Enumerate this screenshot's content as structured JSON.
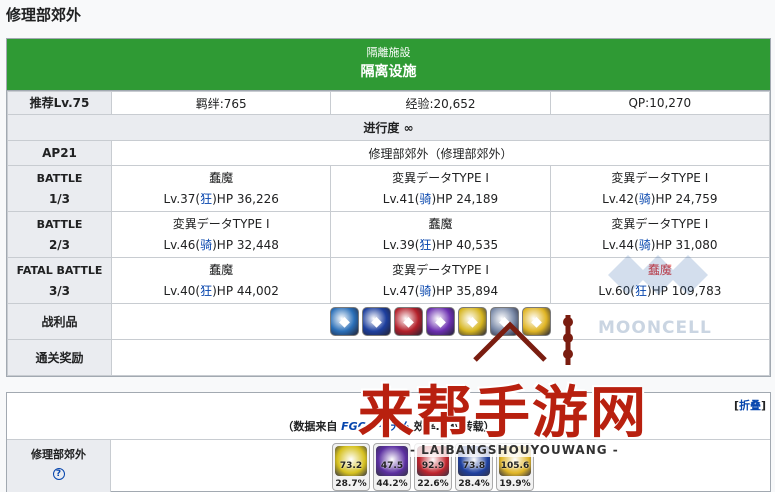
{
  "page": {
    "title": "修理部郊外"
  },
  "quest": {
    "jp_title": "隔離施設",
    "cn_title": "隔离设施",
    "info": {
      "recommend_label": "推荐Lv.75",
      "bond": "羁绊:765",
      "exp": "经验:20,652",
      "qp": "QP:10,270"
    },
    "progress": "进行度 ∞",
    "ap_label": "AP21",
    "location": "修理部郊外（修理部郊外）",
    "battles": [
      {
        "label1": "BATTLE",
        "label2": "1/3",
        "enemies": [
          {
            "name": "蠢魔",
            "lv": "Lv.37(",
            "cls": "狂",
            "hp": ")HP 36,226",
            "boss": false
          },
          {
            "name": "変異データTYPE I",
            "lv": "Lv.41(",
            "cls": "骑",
            "hp": ")HP 24,189",
            "boss": false
          },
          {
            "name": "変異データTYPE I",
            "lv": "Lv.42(",
            "cls": "骑",
            "hp": ")HP 24,759",
            "boss": false
          }
        ]
      },
      {
        "label1": "BATTLE",
        "label2": "2/3",
        "enemies": [
          {
            "name": "変異データTYPE I",
            "lv": "Lv.46(",
            "cls": "骑",
            "hp": ")HP 32,448",
            "boss": false
          },
          {
            "name": "蠢魔",
            "lv": "Lv.39(",
            "cls": "狂",
            "hp": ")HP 40,535",
            "boss": false
          },
          {
            "name": "変異データTYPE I",
            "lv": "Lv.44(",
            "cls": "骑",
            "hp": ")HP 31,080",
            "boss": false
          }
        ]
      },
      {
        "label1": "FATAL BATTLE",
        "label2": "3/3",
        "enemies": [
          {
            "name": "蠢魔",
            "lv": "Lv.40(",
            "cls": "狂",
            "hp": ")HP 44,002",
            "boss": false
          },
          {
            "name": "変異データTYPE I",
            "lv": "Lv.47(",
            "cls": "骑",
            "hp": ")HP 35,894",
            "boss": false
          },
          {
            "name": "蠢魔",
            "lv": "Lv.60(",
            "cls": "狂",
            "hp": ")HP 109,783",
            "boss": true
          }
        ]
      }
    ],
    "drops_label": "战利品",
    "drops": [
      {
        "icon": "blue-crystal-icon",
        "color": "#2a6fb8"
      },
      {
        "icon": "blue-gem-icon",
        "color": "#1d3f9e"
      },
      {
        "icon": "red-gem-icon",
        "color": "#b3202a"
      },
      {
        "icon": "purple-orb-icon",
        "color": "#6b2fb0"
      },
      {
        "icon": "gold-crystal-icon",
        "color": "#d6b51f"
      },
      {
        "icon": "silver-shard-icon",
        "color": "#7a8aa8"
      },
      {
        "icon": "gold-shard-icon",
        "color": "#e0b525"
      }
    ],
    "clear_label": "通关奖励"
  },
  "drop_stats": {
    "fold_label": "折叠",
    "source_prefix": "（数据来自",
    "source_link": "FGOアイテム",
    "source_rest": "效率… 仅转载）",
    "row_label": "修理部郊外",
    "help": "?",
    "items": [
      {
        "icon": "gold-crystal-icon",
        "color": "#d6c11f",
        "value": "73.2",
        "pct": "28.7%"
      },
      {
        "icon": "purple-orb-icon",
        "color": "#5b2fa0",
        "value": "47.5",
        "pct": "44.2%"
      },
      {
        "icon": "red-gem-icon",
        "color": "#c0242c",
        "value": "92.9",
        "pct": "22.6%"
      },
      {
        "icon": "blue-gem-icon",
        "color": "#1d3f9e",
        "value": "73.8",
        "pct": "28.4%"
      },
      {
        "icon": "gold-shard-icon",
        "color": "#e0b525",
        "value": "105.6",
        "pct": "19.9%"
      }
    ]
  },
  "watermarks": {
    "mooncell": "MOONCELL",
    "site_cn": "来帮手游网",
    "site_en": "- LAIBANGSHOUYOUWANG -"
  }
}
